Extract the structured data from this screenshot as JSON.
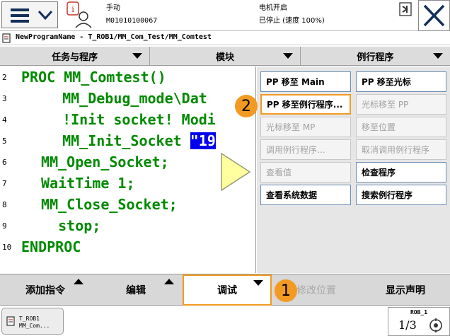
{
  "header": {
    "mode_label": "手动",
    "controller_id": "M01010100067",
    "motor_label": "电机开启",
    "run_state": "已停止 (速度 100%)"
  },
  "path": {
    "text": "NewProgramName - T_ROB1/MM_Com_Test/MM_Comtest"
  },
  "tabs": [
    {
      "label": "任务与程序"
    },
    {
      "label": "模块"
    },
    {
      "label": "例行程序"
    }
  ],
  "code": {
    "line_numbers": [
      "2",
      "3",
      "4",
      "5",
      "6",
      "7",
      "8",
      "9",
      "10"
    ],
    "lines": [
      "PROC MM_Comtest()",
      "  MM_Debug_mode\\Dat",
      "  !Init socket! Modi",
      "  MM_Init_Socket ",
      " MM_Open_Socket;",
      " WaitTime 1;",
      " MM_Close_Socket;",
      "   stop;",
      "ENDPROC"
    ],
    "highlight_text": "\"19"
  },
  "debug_menu": {
    "buttons": [
      {
        "label": "PP 移至 Main"
      },
      {
        "label": "PP 移至光标"
      },
      {
        "label": "PP 移至例行程序..."
      },
      {
        "label": "光标移至 PP"
      },
      {
        "label": "光标移至 MP"
      },
      {
        "label": "移至位置"
      },
      {
        "label": "调用例行程序…"
      },
      {
        "label": "取消调用例行程序"
      },
      {
        "label": "查看值"
      },
      {
        "label": "检查程序"
      },
      {
        "label": "查看系统数据"
      },
      {
        "label": "搜索例行程序"
      }
    ]
  },
  "callouts": [
    "2",
    "1"
  ],
  "toolbar": {
    "add_instruction": "添加指令",
    "edit": "编辑",
    "debug": "调试",
    "modify_position": "修改位置",
    "show_declaration": "显示声明"
  },
  "taskbar": {
    "task_line1": "T_ROB1",
    "task_line2": "MM_Com...",
    "rob_label": "ROB_1",
    "rob_fraction": "1/3"
  },
  "colors": {
    "code_text": "#008a00",
    "highlight": "#0000ee",
    "callout": "#f29a22",
    "selected_border": "#f29a22"
  }
}
